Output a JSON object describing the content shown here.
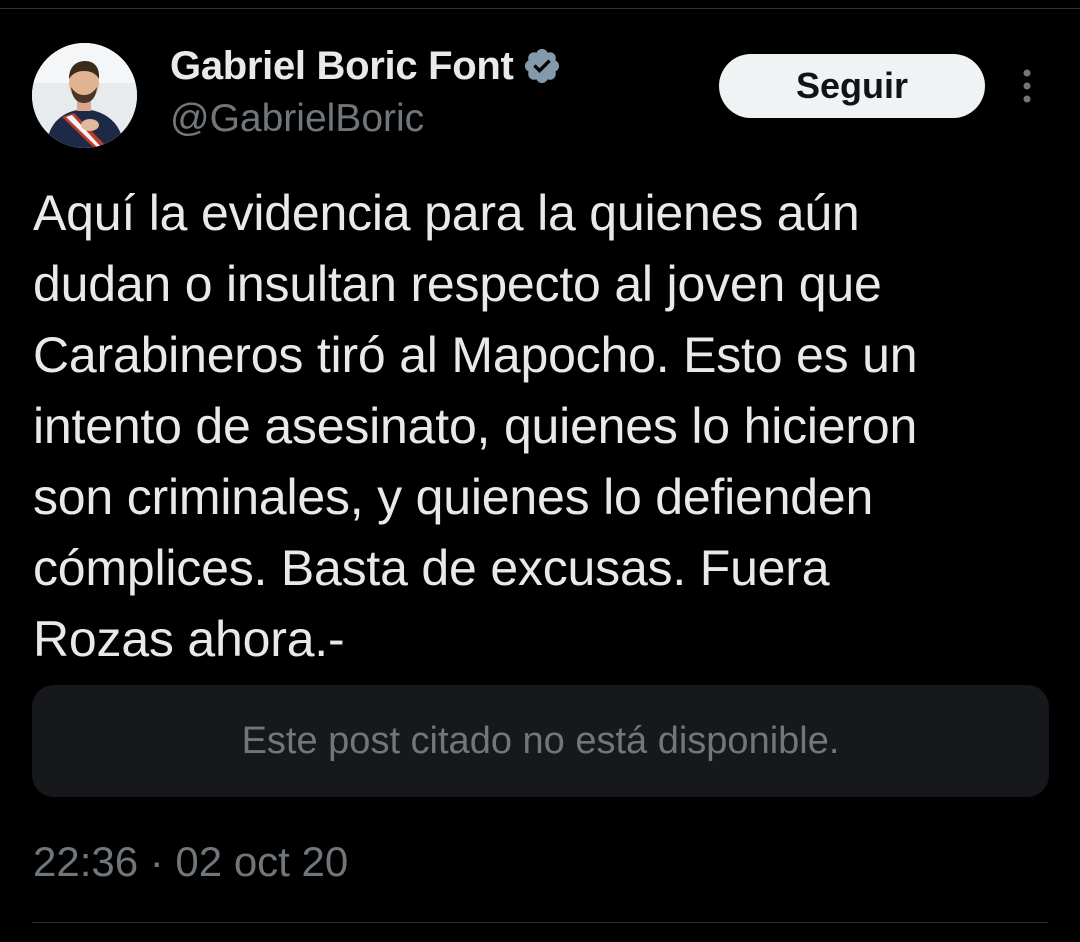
{
  "author": {
    "display_name": "Gabriel Boric Font",
    "handle": "@GabrielBoric",
    "verified": true,
    "avatar_icon": "profile-photo"
  },
  "actions": {
    "follow_label": "Seguir",
    "more_icon": "more-vertical-icon"
  },
  "post": {
    "text": "Aquí la evidencia para la quienes aún\ndudan o insultan respecto al joven que\nCarabineros tiró al Mapocho. Esto es un\nintento de asesinato, quienes lo hicieron\nson criminales, y quienes lo defienden\ncómplices. Basta de excusas. Fuera\nRozas ahora.-",
    "quoted_post_message": "Este post citado no está disponible.",
    "timestamp": "22:36 · 02 oct 20"
  },
  "colors": {
    "background": "#000000",
    "primary_text": "#e7e9ea",
    "secondary_text": "#71767b",
    "verified_badge": "#829aab",
    "follow_button_bg": "#eff3f4",
    "quote_box_bg": "#16181c"
  }
}
